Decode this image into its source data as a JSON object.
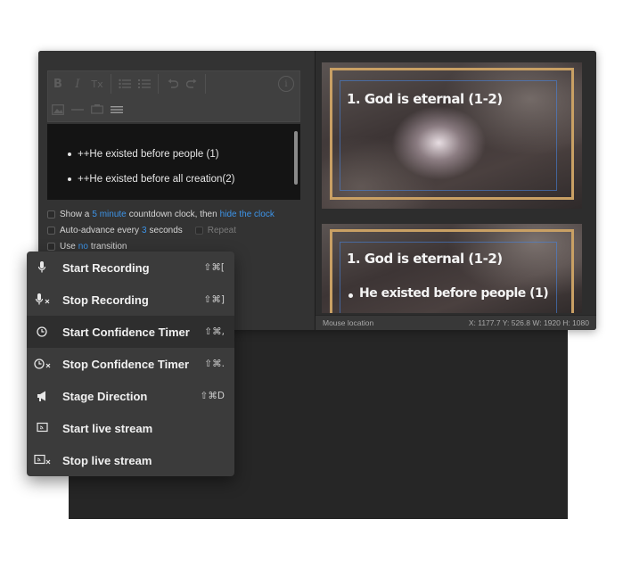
{
  "editor": {
    "toolbar": {
      "bold": "B",
      "italic": "I",
      "clear_format": "Tx",
      "info": "i"
    },
    "bullets": [
      "++He existed before people (1)",
      "++He existed before all creation(2)"
    ]
  },
  "options": {
    "countdown": {
      "pre": "Show a",
      "duration": "5 minute",
      "mid": "countdown clock, then",
      "action": "hide the clock"
    },
    "auto_advance": {
      "pre": "Auto-advance every",
      "seconds": "3",
      "post": "seconds",
      "repeat": "Repeat"
    },
    "transition": {
      "pre": "Use",
      "value": "no",
      "post": "transition"
    }
  },
  "preview": {
    "slide1": {
      "title": "1. God is eternal (1-2)"
    },
    "slide2": {
      "title": "1. God is eternal (1-2)",
      "bullet": "He existed before people (1)"
    },
    "status": {
      "label": "Mouse location",
      "coords": "X: 1177.7  Y: 526.8   W: 1920  H: 1080"
    }
  },
  "menu": {
    "items": [
      {
        "label": "Start Recording",
        "shortcut": "⇧⌘[",
        "icon": "microphone-icon"
      },
      {
        "label": "Stop Recording",
        "shortcut": "⇧⌘]",
        "icon": "microphone-stop-icon"
      },
      {
        "label": "Start Confidence Timer",
        "shortcut": "⇧⌘,",
        "icon": "clock-icon"
      },
      {
        "label": "Stop Confidence Timer",
        "shortcut": "⇧⌘.",
        "icon": "clock-stop-icon"
      },
      {
        "label": "Stage Direction",
        "shortcut": "⇧⌘D",
        "icon": "megaphone-icon"
      },
      {
        "label": "Start live stream",
        "shortcut": "",
        "icon": "cast-icon"
      },
      {
        "label": "Stop live stream",
        "shortcut": "",
        "icon": "cast-stop-icon"
      }
    ],
    "highlighted_index": 2
  }
}
